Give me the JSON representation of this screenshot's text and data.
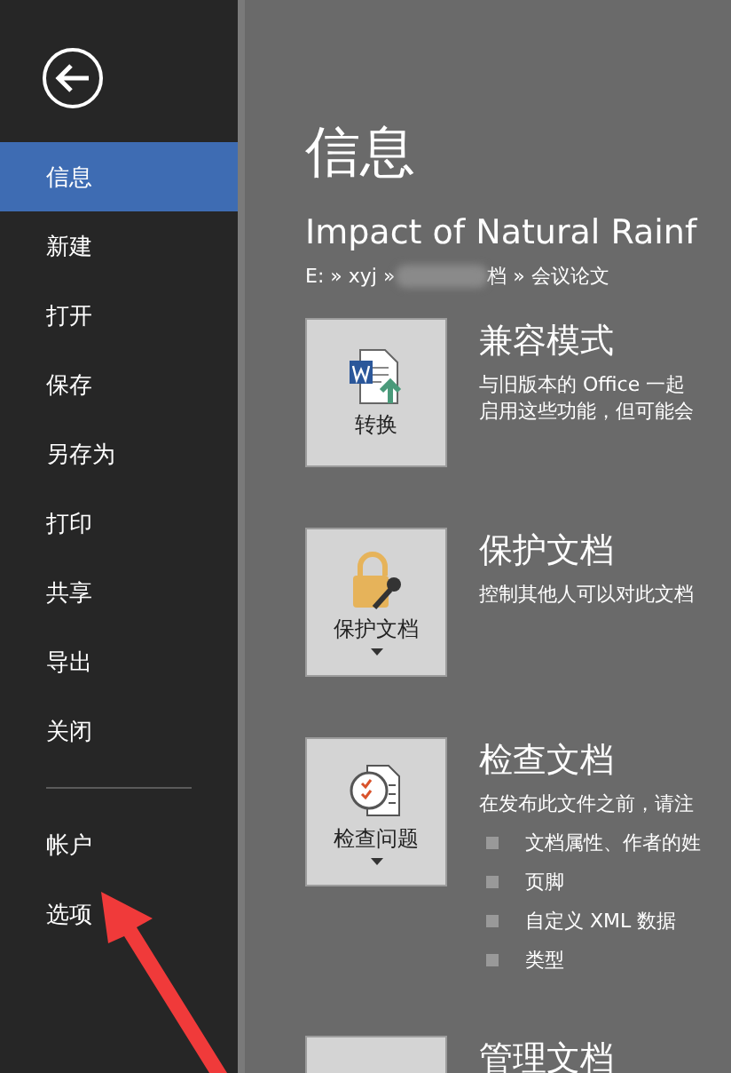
{
  "sidebar": {
    "items": [
      {
        "label": "信息",
        "selected": true
      },
      {
        "label": "新建",
        "selected": false
      },
      {
        "label": "打开",
        "selected": false
      },
      {
        "label": "保存",
        "selected": false
      },
      {
        "label": "另存为",
        "selected": false
      },
      {
        "label": "打印",
        "selected": false
      },
      {
        "label": "共享",
        "selected": false
      },
      {
        "label": "导出",
        "selected": false
      },
      {
        "label": "关闭",
        "selected": false
      }
    ],
    "footer_items": [
      {
        "label": "帐户",
        "selected": false
      },
      {
        "label": "选项",
        "selected": false
      }
    ]
  },
  "page_title": "信息",
  "document_title": "Impact of Natural Rainf",
  "path": {
    "start": "E: » xyj » ",
    "end": "档 » 会议论文"
  },
  "sections": [
    {
      "kind": "convert",
      "button": "转换",
      "title": "兼容模式",
      "description": [
        "与旧版本的 Office 一起",
        "启用这些功能，但可能会"
      ]
    },
    {
      "kind": "protect",
      "button": "保护文档",
      "dropdown": true,
      "title": "保护文档",
      "description": [
        "控制其他人可以对此文档"
      ]
    },
    {
      "kind": "inspect",
      "button": "检查问题",
      "dropdown": true,
      "title": "检查文档",
      "description": [
        "在发布此文件之前，请注"
      ],
      "bullets": [
        "文档属性、作者的姓",
        "页脚",
        "自定义 XML 数据",
        "类型"
      ]
    },
    {
      "kind": "manage",
      "title": "管理文档"
    }
  ]
}
